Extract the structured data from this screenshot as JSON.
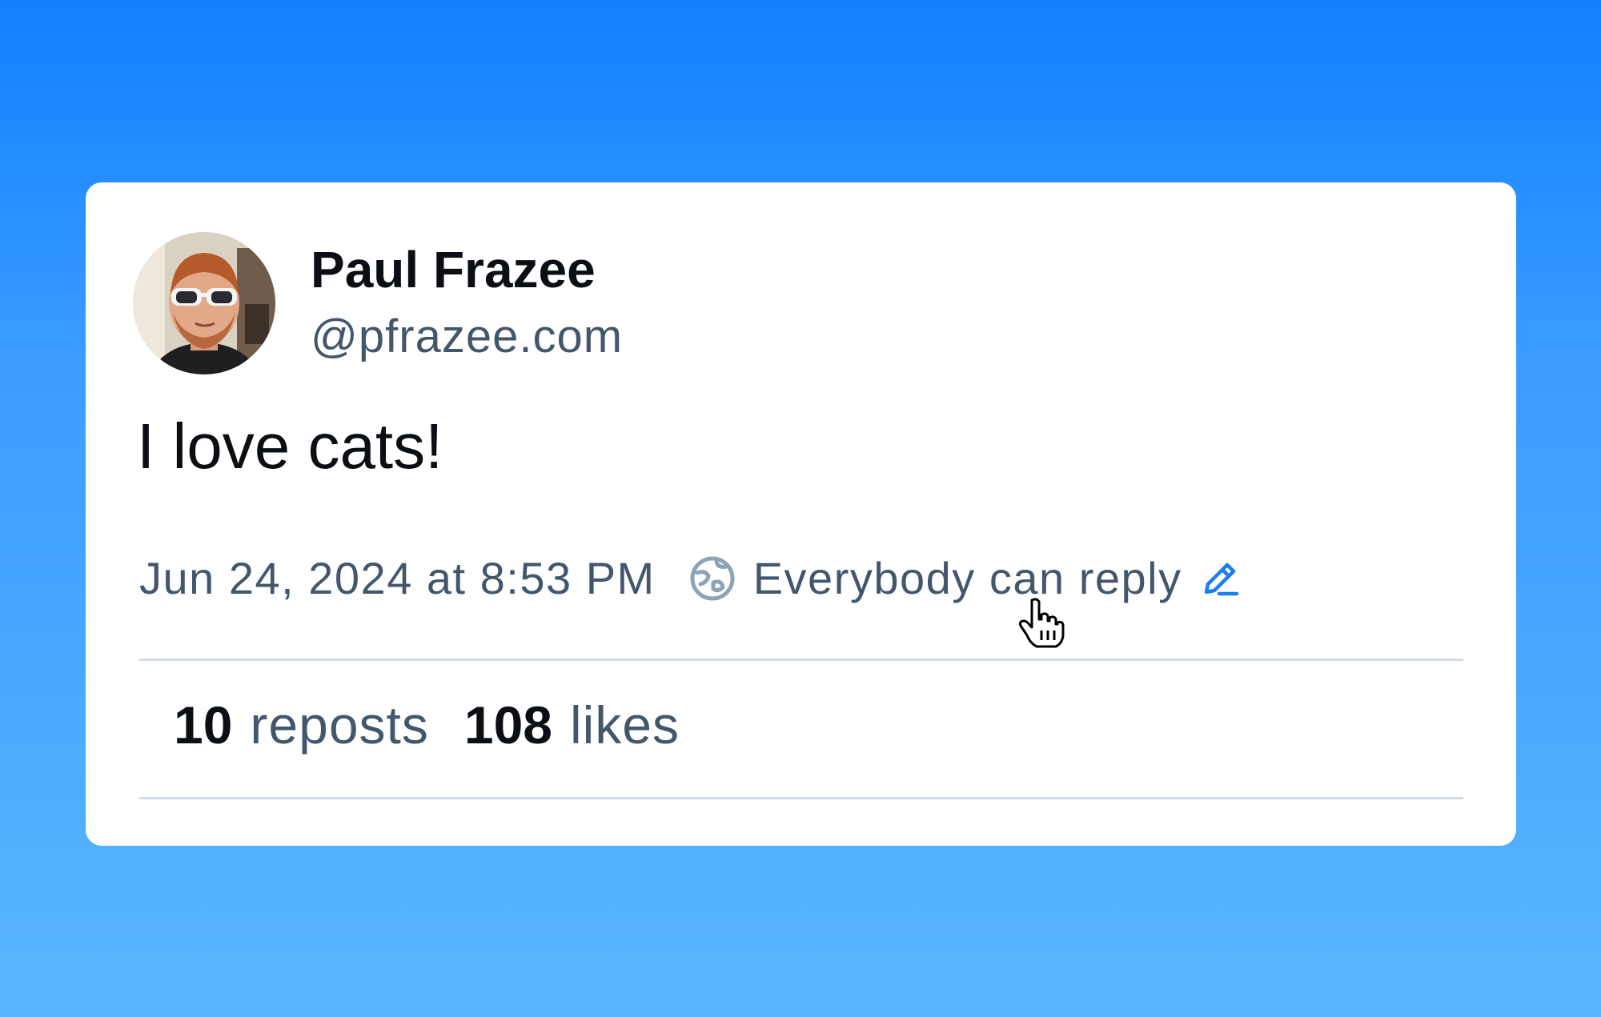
{
  "post": {
    "author": {
      "display_name": "Paul Frazee",
      "handle": "@pfrazee.com",
      "avatar_icon": "avatar-photo"
    },
    "text": "I love cats!",
    "timestamp": "Jun 24, 2024 at 8:53 PM",
    "reply_setting": {
      "icon": "globe-icon",
      "label": "Everybody can reply",
      "edit_icon": "pencil-icon"
    },
    "stats": {
      "reposts_count": "10",
      "reposts_label": "reposts",
      "likes_count": "108",
      "likes_label": "likes"
    }
  },
  "colors": {
    "background_top": "#1180ff",
    "background_bottom": "#5ab6fd",
    "card": "#ffffff",
    "text_primary": "#0b0f14",
    "text_secondary": "#42576c",
    "accent": "#1a7ff5",
    "divider": "#d4dbe2"
  }
}
